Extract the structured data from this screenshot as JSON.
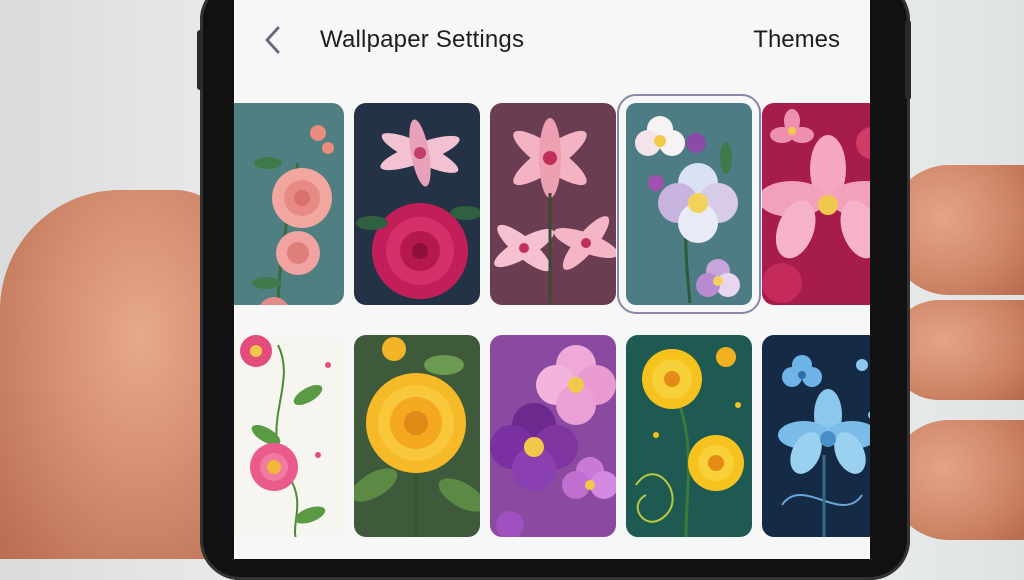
{
  "header": {
    "back_icon": "chevron-left-icon",
    "title": "Wallpaper Settings",
    "themes_label": "Themes"
  },
  "colors": {
    "accent_selected": "#8a87a8",
    "screen_bg": "#f7f7f8",
    "text": "#1e1e22"
  },
  "wallpapers": [
    {
      "id": "pink-roses",
      "row": 1,
      "selected": false
    },
    {
      "id": "lilies-and-magenta-rose",
      "row": 1,
      "selected": false
    },
    {
      "id": "pink-lilies",
      "row": 1,
      "selected": false
    },
    {
      "id": "pastel-blossoms-teal",
      "row": 1,
      "selected": true
    },
    {
      "id": "pink-orchids",
      "row": 1,
      "selected": false
    },
    {
      "id": "pink-daisies-white",
      "row": 2,
      "selected": false
    },
    {
      "id": "yellow-dahlia-green",
      "row": 2,
      "selected": false
    },
    {
      "id": "purple-flowers",
      "row": 2,
      "selected": false
    },
    {
      "id": "yellow-daisies-swirls",
      "row": 2,
      "selected": false
    },
    {
      "id": "blue-flowers-navy",
      "row": 2,
      "selected": false
    }
  ]
}
